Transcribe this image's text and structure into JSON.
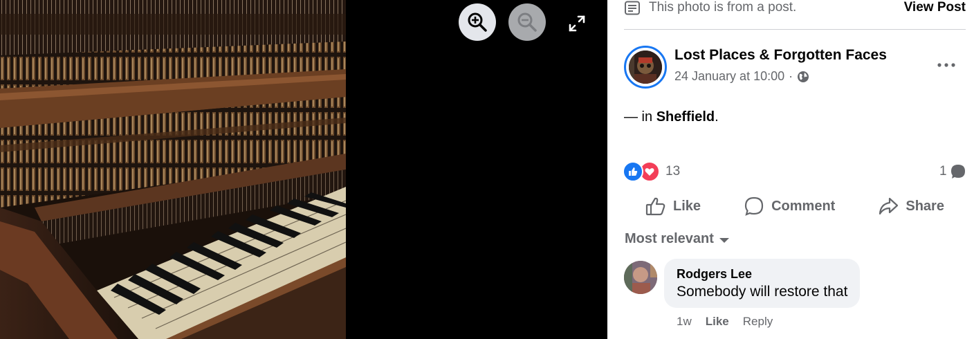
{
  "viewer": {
    "zoom_in_icon": "zoom-in-icon",
    "zoom_out_icon": "zoom-out-icon",
    "fullscreen_icon": "expand-icon"
  },
  "post_notice": {
    "text": "This photo is from a post.",
    "view_post": "View Post"
  },
  "post": {
    "page_name": "Lost Places & Forgotten Faces",
    "date": "24 January at 10:00",
    "separator": "·",
    "audience_icon": "globe-icon",
    "text_prefix": "— in ",
    "location": "Sheffield",
    "text_suffix": "."
  },
  "stats": {
    "reaction_count": "13",
    "comment_count": "1",
    "reactions": [
      "like",
      "love"
    ]
  },
  "actions": {
    "like": "Like",
    "comment": "Comment",
    "share": "Share"
  },
  "comments": {
    "sort_label": "Most relevant",
    "items": [
      {
        "author": "Rodgers Lee",
        "text": "Somebody will restore that",
        "age": "1w",
        "like": "Like",
        "reply": "Reply"
      }
    ]
  },
  "colors": {
    "accent": "#1877f2",
    "love": "#f33e58",
    "secondary_text": "#65676b",
    "bubble": "#f0f2f5"
  }
}
